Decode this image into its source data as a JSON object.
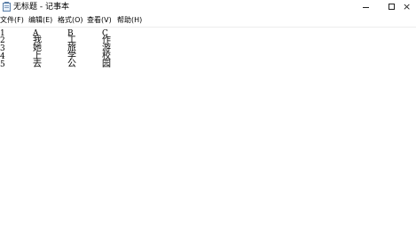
{
  "window": {
    "title": "无标题 - 记事本",
    "icon": "notepad-icon",
    "controls": {
      "minimize": "minimize-icon",
      "maximize": "maximize-icon",
      "close": "close-icon"
    },
    "close_glyph": "×"
  },
  "menubar": {
    "items": [
      {
        "label": "文件(F)"
      },
      {
        "label": "编辑(E)"
      },
      {
        "label": "格式(O)"
      },
      {
        "label": "查看(V)"
      },
      {
        "label": "帮助(H)"
      }
    ]
  },
  "editor": {
    "rows": [
      [
        "1",
        "A",
        "B",
        "C"
      ],
      [
        "2",
        "我",
        "工",
        "作"
      ],
      [
        "3",
        "她",
        "旅",
        "游"
      ],
      [
        "4",
        "上",
        "学",
        "校"
      ],
      [
        "5",
        "去",
        "公",
        "园"
      ]
    ]
  }
}
